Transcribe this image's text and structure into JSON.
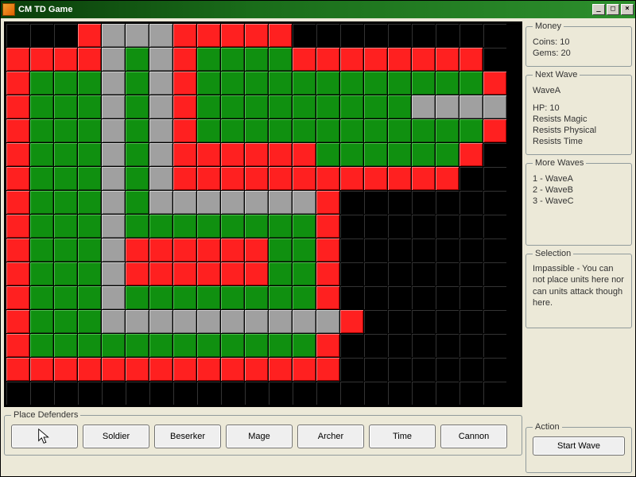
{
  "window": {
    "title": "CM TD Game"
  },
  "money": {
    "legend": "Money",
    "coins_label": "Coins:",
    "coins": 10,
    "gems_label": "Gems:",
    "gems": 20
  },
  "next_wave": {
    "legend": "Next Wave",
    "name": "WaveA",
    "hp_label": "HP:",
    "hp": 10,
    "resists": [
      "Resists Magic",
      "Resists Physical",
      "Resists Time"
    ]
  },
  "more_waves": {
    "legend": "More Waves",
    "items": [
      "1 - WaveA",
      "2 - WaveB",
      "3 - WaveC"
    ]
  },
  "selection": {
    "legend": "Selection",
    "text": "Impassible - You can not place units here nor can units attack though here."
  },
  "action": {
    "legend": "Action",
    "start_wave": "Start Wave"
  },
  "defenders": {
    "legend": "Place Defenders",
    "cursor": "cursor",
    "buttons": [
      "Soldier",
      "Beserker",
      "Mage",
      "Archer",
      "Time",
      "Cannon"
    ]
  },
  "map": {
    "cols": 21,
    "rows": 16,
    "legend_colors": {
      "b": "#000000",
      "r": "#ff2020",
      "g": "#109010",
      "p": "#a0a0a0"
    },
    "tiles": [
      "bbbrppprrrrrbbbbbbbbb",
      "rrrrpgprggggrrrrrrrrb",
      "rgggpgprggggggggggggr",
      "rgggpgprgggggggggpppp",
      "rgggpgprggggggggggggr",
      "rgggpgprrrrrrggggggrb",
      "rgggpgprrrrrrrrrrrrbb",
      "rgggpgppppppprbbbbbbb",
      "rgggpggggggggrbbbbbbb",
      "rgggprrrrrrggrbbbbbbb",
      "rgggprrrrrrggrbbbbbbb",
      "rgggpggggggggrbbbbbbb",
      "rgggpppppppppprbbbbbb",
      "rggggggggggggrbbbbbbb",
      "rrrrrrrrrrrrrrbbbbbbb",
      "bbbbbbbbbbbbbbbbbbbbb"
    ]
  }
}
